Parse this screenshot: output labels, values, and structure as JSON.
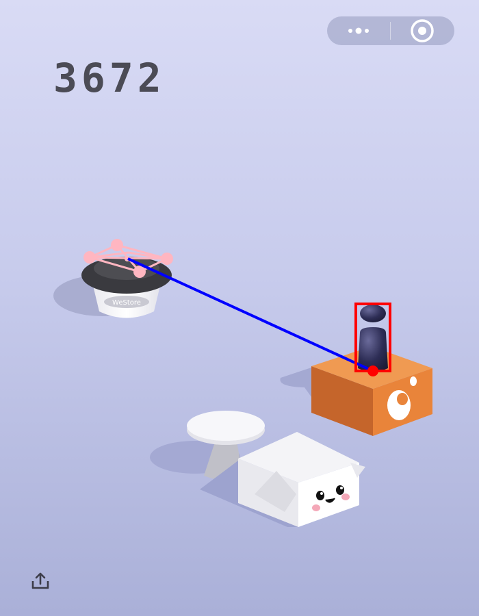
{
  "hud": {
    "score": "3672"
  },
  "capsule": {
    "more_icon": "more-dots-icon",
    "close_icon": "target-close-icon"
  },
  "platforms": {
    "cup_logo_text": "WeStore"
  },
  "share": {
    "icon": "share-upload-icon"
  },
  "colors": {
    "background_top": "#d9dbf5",
    "background_bottom": "#aab0d8",
    "score": "#4b4b55",
    "orange_box": "#e9843a",
    "trajectory_line": "#0000ff",
    "target_marker": "#ff0000",
    "keypoints": "#ffb6c1"
  }
}
